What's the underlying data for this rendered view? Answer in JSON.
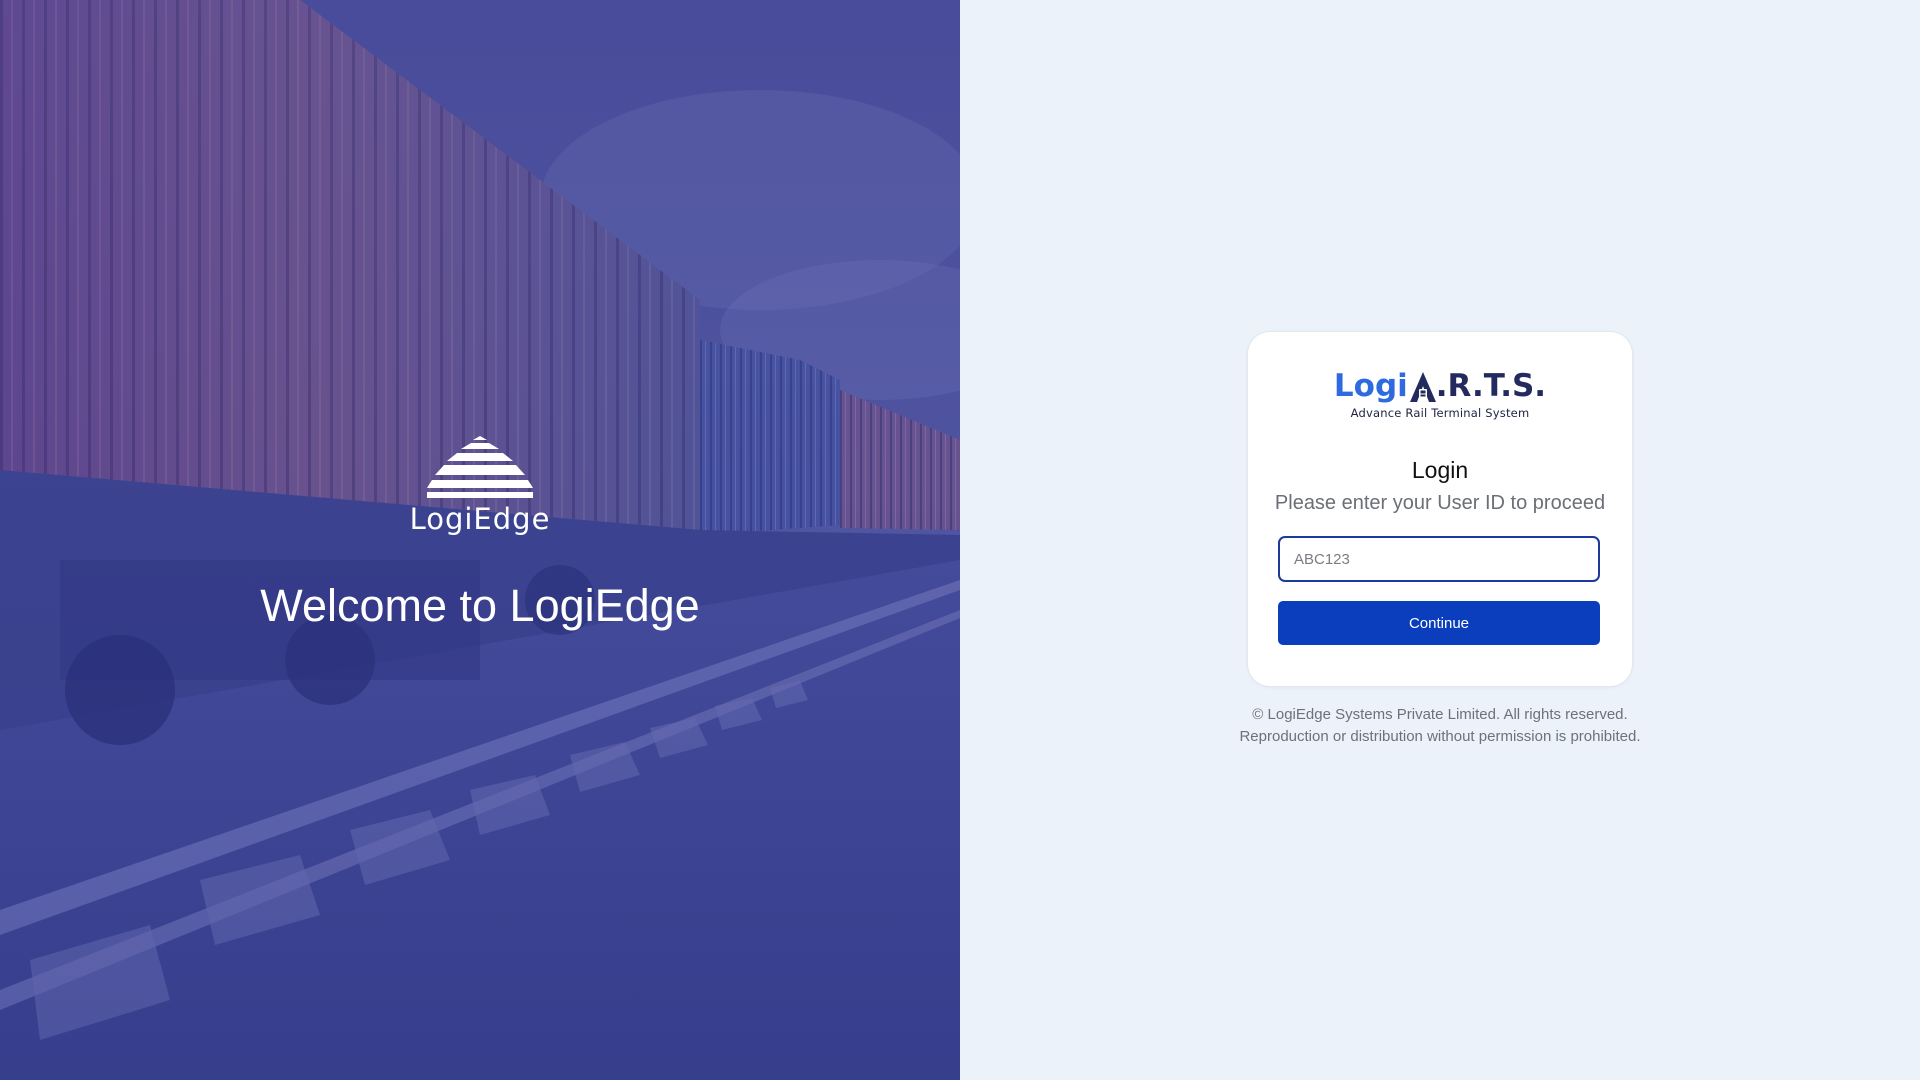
{
  "hero": {
    "logo_text": "LogiEdge",
    "welcome": "Welcome to LogiEdge",
    "logo_icon": "rail-track-icon"
  },
  "brand": {
    "logi": "Logi",
    "rts": ".R.T.S.",
    "subtitle": "Advance Rail Terminal System",
    "a_icon": "tower-a-icon"
  },
  "login": {
    "title": "Login",
    "subtitle": "Please enter your User ID to proceed",
    "input_placeholder": "ABC123",
    "continue_label": "Continue"
  },
  "footer": {
    "line1": "© LogiEdge Systems Private Limited. All rights reserved.",
    "line2": "Reproduction or distribution without permission is prohibited."
  },
  "colors": {
    "primary": "#0a3ebc",
    "brand_blue": "#2e6be0",
    "brand_navy": "#232b5e",
    "panel_bg": "#ebf2fa",
    "hero_tint": "#414a9a"
  }
}
